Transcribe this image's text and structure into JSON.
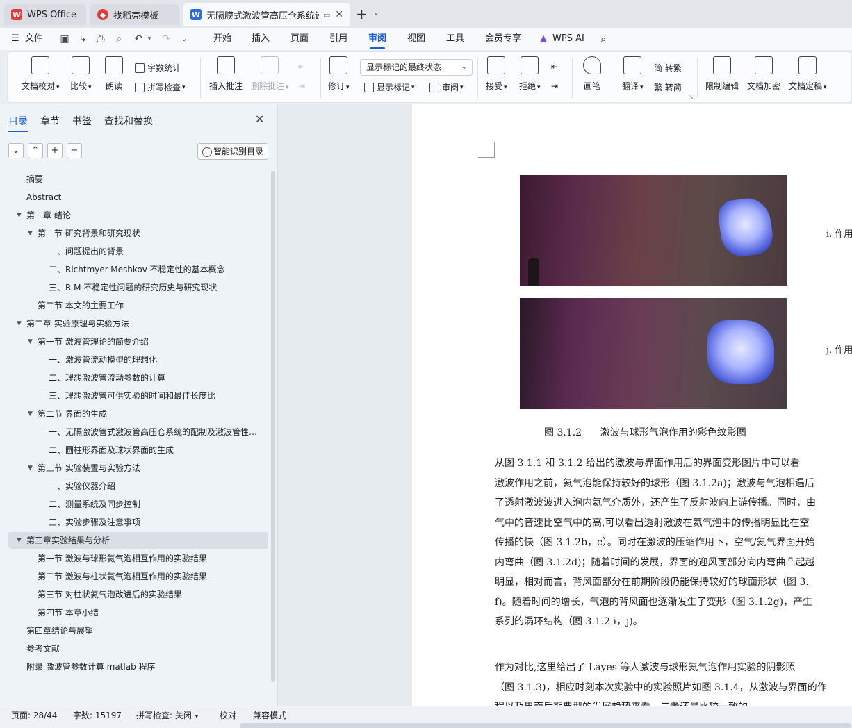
{
  "tabs": [
    {
      "label": "WPS Office",
      "icon": "wps-logo-icon"
    },
    {
      "label": "找稻壳模板",
      "icon": "docer-icon"
    },
    {
      "label": "无隔膜式激波管高压仓系统设计",
      "icon": "writer-doc-icon"
    }
  ],
  "menu": {
    "file": "文件",
    "items": [
      "开始",
      "插入",
      "页面",
      "引用",
      "审阅",
      "视图",
      "工具",
      "会员专享"
    ],
    "active": "审阅",
    "ai": "WPS AI"
  },
  "ribbon": {
    "proofread": "文档校对",
    "compare": "比较",
    "read_aloud": "朗读",
    "word_count": "字数统计",
    "spell_check": "拼写检查",
    "insert_comment": "插入批注",
    "delete_comment": "删除批注",
    "revise": "修订",
    "markup_dropdown": "显示标记的最终状态",
    "show_markup": "显示标记",
    "review": "审阅",
    "accept": "接受",
    "reject": "拒绝",
    "pen": "画笔",
    "translate": "翻译",
    "to_traditional": "简 转繁",
    "to_simplified": "繁 转简",
    "restrict_edit": "限制编辑",
    "encrypt": "文档加密",
    "finalize": "文档定稿"
  },
  "nav": {
    "tabs": [
      "目录",
      "章节",
      "书签",
      "查找和替换"
    ],
    "smart_button": "智能识别目录",
    "toc": [
      {
        "level": 0,
        "text": "摘要",
        "tri": ""
      },
      {
        "level": 0,
        "text": "Abstract",
        "tri": ""
      },
      {
        "level": 0,
        "text": "第一章   绪论",
        "tri": "▼"
      },
      {
        "level": 1,
        "text": "第一节  研究背景和研究现状",
        "tri": "▼"
      },
      {
        "level": 2,
        "text": "一、问题提出的背景",
        "tri": ""
      },
      {
        "level": 2,
        "text": "二、Richtmyer-Meshkov 不稳定性的基本概念",
        "tri": ""
      },
      {
        "level": 2,
        "text": "三、R-M 不稳定性问题的研究历史与研究现状",
        "tri": ""
      },
      {
        "level": 1,
        "text": "第二节      本文的主要工作",
        "tri": ""
      },
      {
        "level": 0,
        "text": "第二章   实验原理与实验方法",
        "tri": "▼"
      },
      {
        "level": 1,
        "text": "第一节  激波管理论的简要介绍",
        "tri": "▼"
      },
      {
        "level": 2,
        "text": "一、激波管流动模型的理想化",
        "tri": ""
      },
      {
        "level": 2,
        "text": "二、理想激波管流动参数的计算",
        "tri": ""
      },
      {
        "level": 2,
        "text": "三、理想激波管可供实验的时间和最佳长度比",
        "tri": ""
      },
      {
        "level": 1,
        "text": "第二节    界面的生成",
        "tri": "▼"
      },
      {
        "level": 2,
        "text": "一、无隔激波管式激波管高压仓系统的配制及激波管性能测试",
        "tri": ""
      },
      {
        "level": 2,
        "text": "二、圆柱形界面及球状界面的生成",
        "tri": ""
      },
      {
        "level": 1,
        "text": "第三节    实验装置与实验方法",
        "tri": "▼"
      },
      {
        "level": 2,
        "text": "一、实验仪器介绍",
        "tri": ""
      },
      {
        "level": 2,
        "text": "二、测量系统及同步控制",
        "tri": ""
      },
      {
        "level": 2,
        "text": "三、实验步骤及注意事项",
        "tri": ""
      },
      {
        "level": 0,
        "text": "第三章实验结果与分析",
        "tri": "▼",
        "selected": true
      },
      {
        "level": 1,
        "text": "第一节    激波与球形氦气泡相互作用的实验结果",
        "tri": ""
      },
      {
        "level": 1,
        "text": "第二节    激波与柱状氦气泡相互作用的实验结果",
        "tri": ""
      },
      {
        "level": 1,
        "text": "第三节    对柱状氦气泡改进后的实验结果",
        "tri": ""
      },
      {
        "level": 1,
        "text": "第四节      本章小结",
        "tri": ""
      },
      {
        "level": 0,
        "text": "第四章结论与展望",
        "tri": ""
      },
      {
        "level": 0,
        "text": "参考文献",
        "tri": ""
      },
      {
        "level": 0,
        "text": "附录   激波管参数计算 matlab 程序",
        "tri": ""
      }
    ]
  },
  "document": {
    "side_labels": [
      "i. 作用",
      "j. 作用"
    ],
    "caption": "图 3.1.2      激波与球形气泡作用的彩色纹影图",
    "para1": [
      "    从图 3.1.1 和 3.1.2 给出的激波与界面作用后的界面变形图片中可以看",
      "激波作用之前，氦气泡能保持较好的球形（图 3.1.2a)；激波与气泡相遇后",
      "了透射激波波进入泡内氦气介质外，还产生了反射波向上游传播。同时，由",
      "气中的音速比空气中的高,可以看出透射激波在氦气泡中的传播明显比在空",
      "传播的快（图 3.1.2b，c）。同时在激波的压缩作用下，空气/氦气界面开始",
      "内弯曲（图 3.1.2d)；随着时间的发展，界面的迎风面部分向内弯曲凸起越",
      "明显，相对而言，背风面部分在前期阶段仍能保持较好的球面形状（图 3.",
      "f)。随着时间的增长，气泡的背风面也逐渐发生了变形（图 3.1.2g)，产生",
      "系列的涡环结构（图 3.1.2 i，j)。"
    ],
    "para2": [
      "    作为对比,这里给出了 Layes 等人激波与球形氦气泡作用实验的阴影照",
      "（图 3.1.3)，相应时刻本次实验中的实验照片如图 3.1.4，从激波与界面的作",
      "程以及界面后期典型的发展趋势来看，二者还是比较一致的"
    ]
  },
  "status": {
    "page": "页面: 28/44",
    "words": "字数: 15197",
    "spell": "拼写检查: 关闭",
    "proof": "校对",
    "compat": "兼容模式"
  },
  "colors": {
    "accent": "#1a5fd6",
    "wps_red": "#e23b3b",
    "writer_blue": "#2d6de0"
  }
}
